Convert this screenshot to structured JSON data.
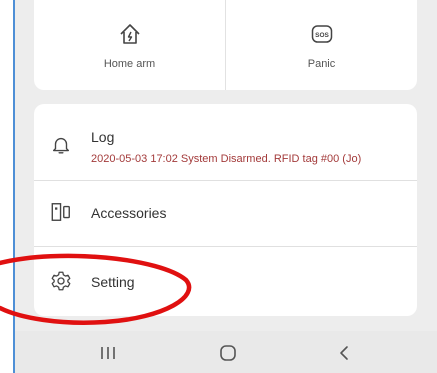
{
  "quick_actions": {
    "home_arm": {
      "label": "Home arm",
      "icon": "home-arm-icon"
    },
    "panic": {
      "label": "Panic",
      "icon": "sos-icon",
      "badge": "SOS"
    }
  },
  "menu": {
    "log": {
      "title": "Log",
      "detail": "2020-05-03 17:02 System Disarmed.  RFID tag #00 (Jo)",
      "icon": "bell-icon"
    },
    "accessories": {
      "title": "Accessories",
      "icon": "accessories-icon"
    },
    "setting": {
      "title": "Setting",
      "icon": "gear-icon"
    }
  },
  "navigation_bar": {
    "recents": "recents-icon",
    "home": "home-circle-icon",
    "back": "back-chevron-icon"
  },
  "colors": {
    "log_detail": "#a33a3a",
    "annotation": "#e01010",
    "frame": "#4e8fd6"
  }
}
